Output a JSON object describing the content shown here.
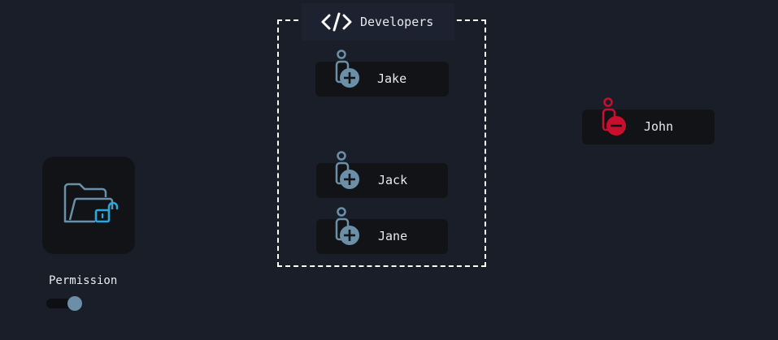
{
  "group": {
    "title": "Developers",
    "icon": "code-icon",
    "members": [
      {
        "name": "Jake",
        "status": "add"
      },
      {
        "name": "Jack",
        "status": "add"
      },
      {
        "name": "Jane",
        "status": "add"
      }
    ]
  },
  "outside_user": {
    "name": "John",
    "status": "remove"
  },
  "permission": {
    "label": "Permission",
    "icon": "folder-lock-icon",
    "toggle_on": true
  },
  "colors": {
    "background": "#1a1e29",
    "card": "#111317",
    "add_accent": "#6c8fa8",
    "remove_accent": "#c8102e",
    "lock_accent": "#2aa7d9"
  }
}
